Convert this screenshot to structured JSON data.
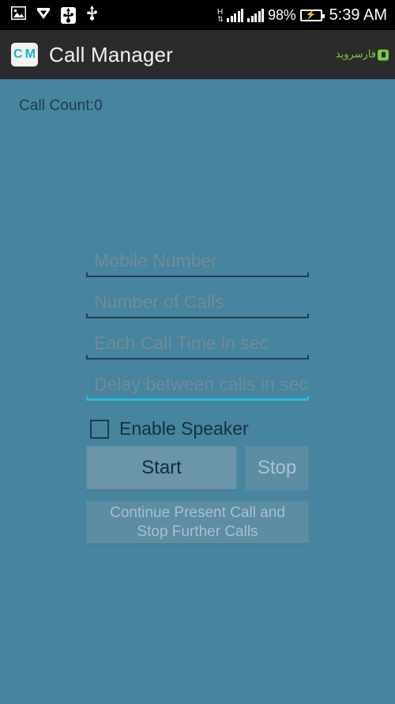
{
  "status_bar": {
    "icons_left": [
      "image-icon",
      "download-chevron-icon",
      "usb-connected-icon",
      "usb-icon"
    ],
    "network_type": "H",
    "network_arrows": "⇅",
    "battery_percent": "98%",
    "battery_state": "charging",
    "time": "5:39 AM"
  },
  "toolbar": {
    "app_icon_letters": [
      "C",
      "M"
    ],
    "title": "Call Manager",
    "watermark_text": "فارسروید"
  },
  "main": {
    "call_count_label": "Call Count:0",
    "fields": [
      {
        "name": "mobile-number",
        "placeholder": "Mobile Number",
        "value": "",
        "focused": false
      },
      {
        "name": "number-of-calls",
        "placeholder": "Number of Calls",
        "value": "",
        "focused": false
      },
      {
        "name": "each-call-time",
        "placeholder": "Each Call Time in sec",
        "value": "",
        "focused": false
      },
      {
        "name": "delay-between-calls",
        "placeholder": "Delay between calls in sec",
        "value": "",
        "focused": true
      }
    ],
    "checkbox": {
      "label": "Enable Speaker",
      "checked": false
    },
    "buttons": {
      "start": "Start",
      "stop": "Stop",
      "continue": "Continue Present Call and Stop Further Calls"
    }
  },
  "colors": {
    "background": "#46849f",
    "toolbar": "#2b2b2b",
    "status_bar": "#000000",
    "accent_focus": "#2bb9e0",
    "app_icon_letter": "#18b4c8",
    "watermark": "#7ac943",
    "button": "#6b95a9",
    "button_disabled_text": "#a8c3d0"
  }
}
